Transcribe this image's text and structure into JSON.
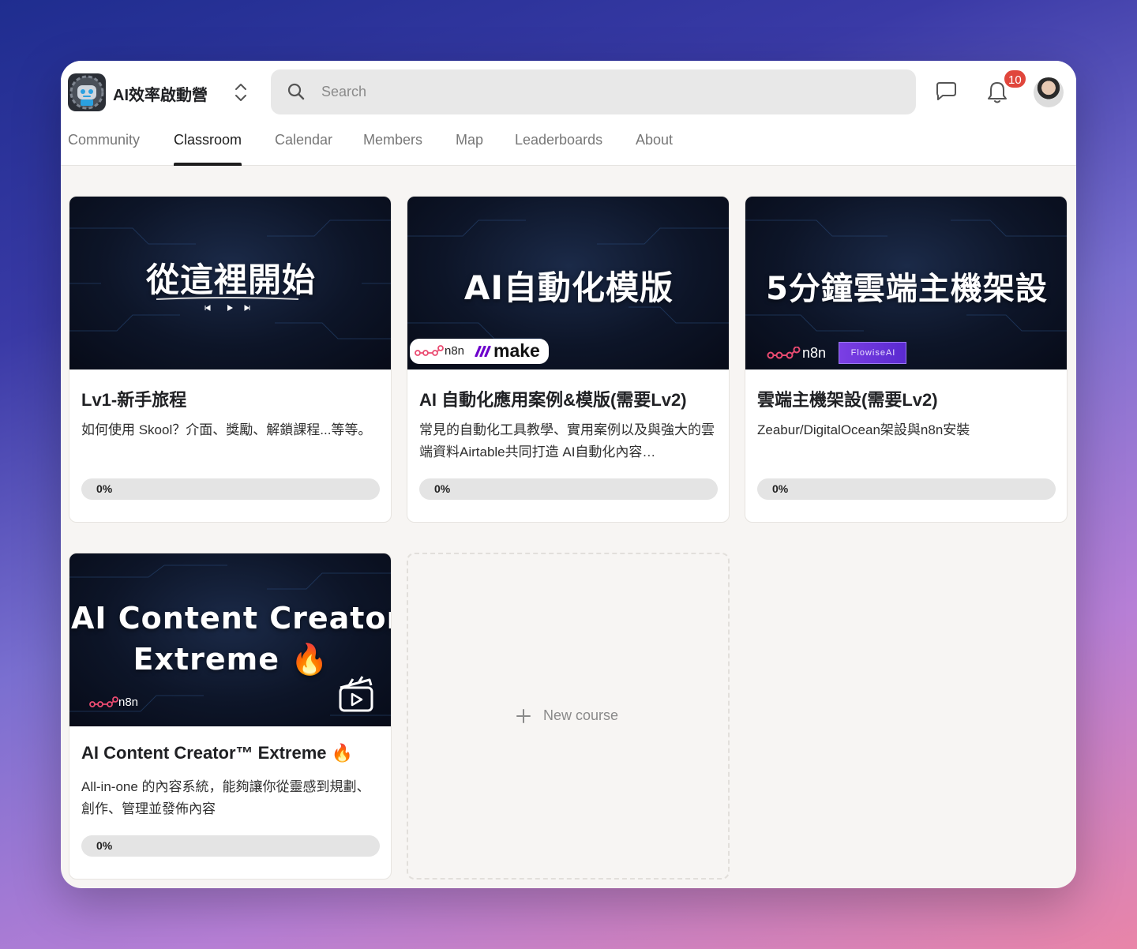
{
  "header": {
    "community_name": "AI效率啟動營",
    "search_placeholder": "Search",
    "notification_count": "10"
  },
  "nav": {
    "tabs": [
      {
        "label": "Community",
        "active": false
      },
      {
        "label": "Classroom",
        "active": true
      },
      {
        "label": "Calendar",
        "active": false
      },
      {
        "label": "Members",
        "active": false
      },
      {
        "label": "Map",
        "active": false
      },
      {
        "label": "Leaderboards",
        "active": false
      },
      {
        "label": "About",
        "active": false
      }
    ]
  },
  "courses": [
    {
      "thumb_title": "從這裡開始",
      "title": "Lv1-新手旅程",
      "description": "如何使用 Skool？介面、獎勵、解鎖課程...等等。",
      "progress": "0%"
    },
    {
      "thumb_title": "AI自動化模版",
      "thumb_badges": [
        "n8n",
        "make"
      ],
      "title": "AI 自動化應用案例&模版(需要Lv2)",
      "description": "常見的自動化工具教學、實用案例以及與強大的雲端資料Airtable共同打造 AI自動化內容…",
      "progress": "0%"
    },
    {
      "thumb_title": "5分鐘雲端主機架設",
      "thumb_badges": [
        "n8n",
        "FlowiseAI"
      ],
      "title": "雲端主機架設(需要Lv2)",
      "description": "Zeabur/DigitalOcean架設與n8n安裝",
      "progress": "0%"
    },
    {
      "thumb_title_line1": "AI Content Creator™",
      "thumb_title_line2": "Extreme 🔥",
      "thumb_badges": [
        "n8n"
      ],
      "title": "AI Content Creator™ Extreme 🔥",
      "description": "All-in-one 的內容系統，能夠讓你從靈感到規劃、創作、管理並發佈內容",
      "progress": "0%"
    }
  ],
  "new_course": {
    "label": "New course"
  },
  "colors": {
    "badge": "#e0463c",
    "accent_underline": "#1e1e1e",
    "make_purple": "#6d00cc",
    "n8n_pink": "#ea4b71"
  }
}
